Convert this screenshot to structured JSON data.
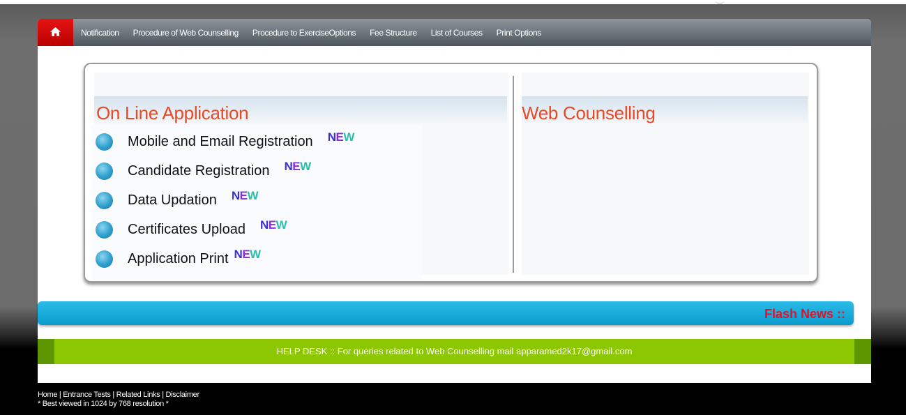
{
  "nav": {
    "home_icon": "home-icon",
    "items": [
      {
        "label": "Notification"
      },
      {
        "label": "Procedure of Web Counselling"
      },
      {
        "label": "Procedure to ExerciseOptions"
      },
      {
        "label": "Fee Structure"
      },
      {
        "label": "List of Courses"
      },
      {
        "label": "Print Options"
      }
    ]
  },
  "online_application": {
    "title": "On Line Application",
    "badge": [
      "N",
      "E",
      "W"
    ],
    "items": [
      {
        "label": "Mobile and Email Registration"
      },
      {
        "label": "Candidate Registration"
      },
      {
        "label": "Data Updation"
      },
      {
        "label": "Certificates Upload"
      },
      {
        "label": "Application Print"
      }
    ]
  },
  "web_counselling": {
    "title": "Web Counselling"
  },
  "flash": {
    "label": "Flash News ::"
  },
  "helpdesk": {
    "text": "HELP DESK :: For queries related to Web Counselling mail apparamed2k17@gmail.com"
  },
  "footer": {
    "links": [
      "Home",
      "Entrance Tests",
      "Related Links",
      "Disclaimer"
    ],
    "separator": " | ",
    "note": "* Best viewed in 1024 by 768 resolution *"
  },
  "colors": {
    "nav_home_red": "#d80a0a",
    "section_title": "#e74a26",
    "flash_bar": "#1aaede",
    "flash_text": "#e0132b",
    "helpdesk_green": "#8dc701"
  }
}
